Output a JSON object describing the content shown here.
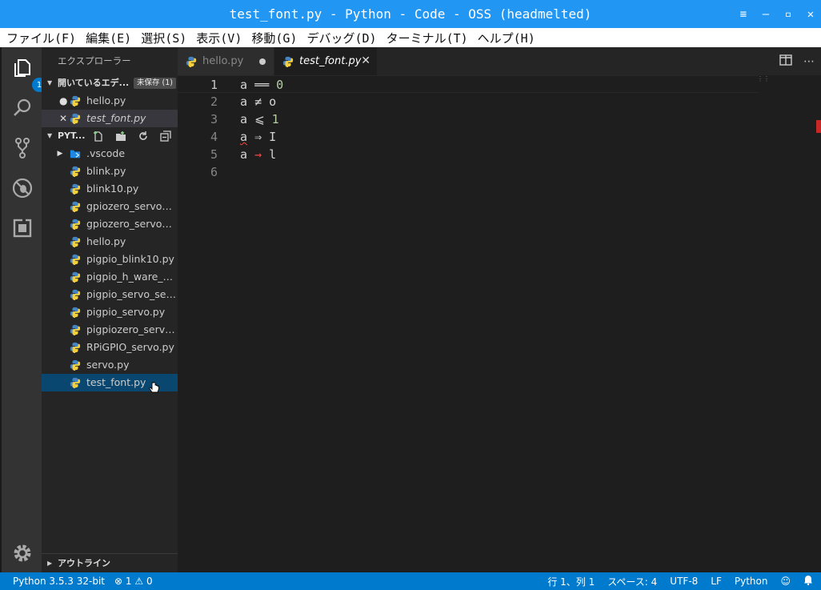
{
  "window": {
    "title": "test_font.py - Python - Code - OSS (headmelted)",
    "controls": [
      "≡",
      "—",
      "▫",
      "✕"
    ]
  },
  "menu": [
    "ファイル(F)",
    "編集(E)",
    "選択(S)",
    "表示(V)",
    "移動(G)",
    "デバッグ(D)",
    "ターミナル(T)",
    "ヘルプ(H)"
  ],
  "activity": {
    "explorer_badge": "1"
  },
  "sidebar": {
    "title": "エクスプローラー",
    "open_editors": {
      "header": "開いているエデ...",
      "unsaved_badge": "未保存 (1)",
      "items": [
        {
          "lead": "●",
          "name": "hello.py"
        },
        {
          "lead": "✕",
          "name": "test_font.py"
        }
      ]
    },
    "project": {
      "header": "PYT...",
      "items": [
        {
          "name": ".vscode",
          "type": "folder"
        },
        {
          "name": "blink.py"
        },
        {
          "name": "blink10.py"
        },
        {
          "name": "gpiozero_servo_..."
        },
        {
          "name": "gpiozero_servo_f..."
        },
        {
          "name": "hello.py"
        },
        {
          "name": "pigpio_blink10.py"
        },
        {
          "name": "pigpio_h_ware_s..."
        },
        {
          "name": "pigpio_servo_ser..."
        },
        {
          "name": "pigpio_servo.py"
        },
        {
          "name": "pigpiozero_servo..."
        },
        {
          "name": "RPiGPIO_servo.py"
        },
        {
          "name": "servo.py"
        },
        {
          "name": "test_font.py"
        }
      ]
    },
    "outline_label": "アウトライン"
  },
  "tabs": [
    {
      "name": "hello.py",
      "state": "modified"
    },
    {
      "name": "test_font.py",
      "state": "active"
    }
  ],
  "editor": {
    "lines": [
      {
        "n": "1",
        "a": "a",
        "op": "══",
        "b": "0"
      },
      {
        "n": "2",
        "a": "a",
        "op": "≠",
        "b": "o"
      },
      {
        "n": "3",
        "a": "a",
        "op": "⩽",
        "b": "1"
      },
      {
        "n": "4",
        "a": "a",
        "op": "⇒",
        "b": "I"
      },
      {
        "n": "5",
        "a": "a",
        "op": "→",
        "b": "l"
      },
      {
        "n": "6",
        "a": "",
        "op": "",
        "b": ""
      }
    ]
  },
  "status": {
    "python": "Python 3.5.3 32-bit",
    "errors": "1",
    "warnings": "0",
    "position": "行 1、列 1",
    "spaces": "スペース: 4",
    "encoding": "UTF-8",
    "eol": "LF",
    "language": "Python"
  },
  "colors": {
    "titlebar": "#2196f3",
    "statusbar": "#007acc",
    "selection": "#094771",
    "number": "#b5cea8",
    "error": "#f44747"
  }
}
